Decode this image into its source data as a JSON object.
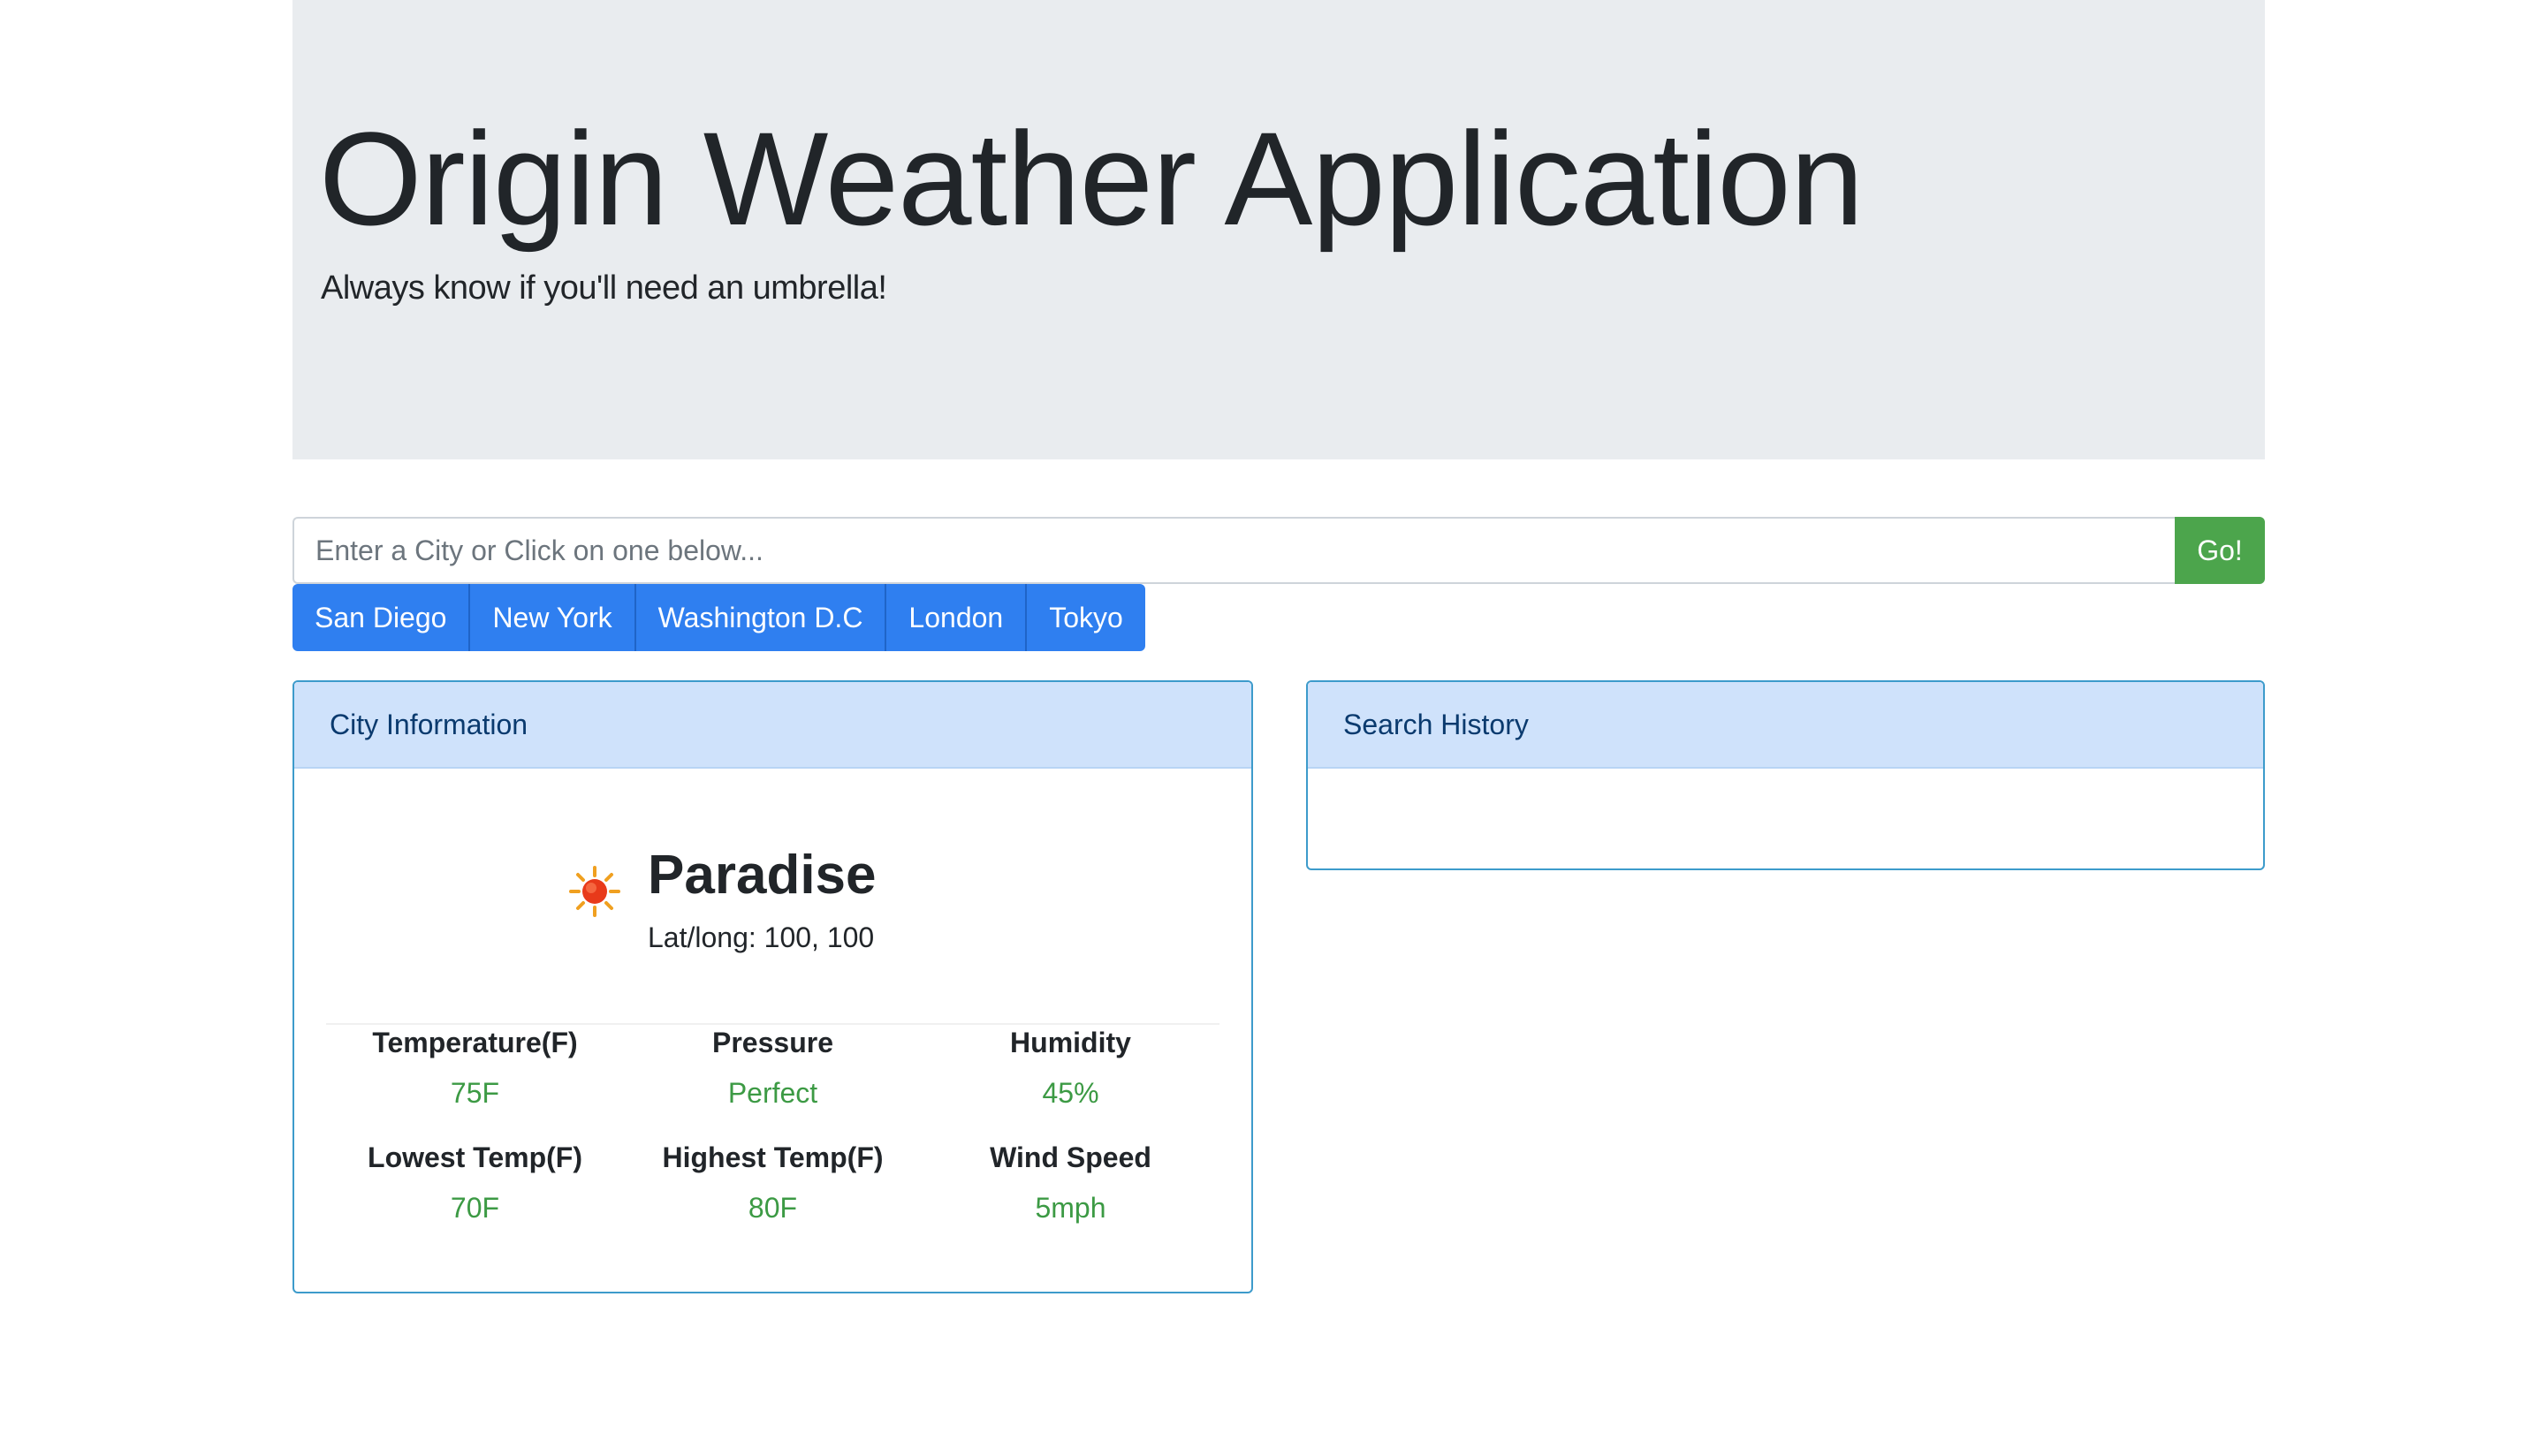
{
  "header": {
    "title": "Origin Weather Application",
    "subtitle": "Always know if you'll need an umbrella!"
  },
  "search": {
    "placeholder": "Enter a City or Click on one below...",
    "value": "",
    "go_label": "Go!"
  },
  "quick_cities": [
    "San Diego",
    "New York",
    "Washington D.C",
    "London",
    "Tokyo"
  ],
  "city_card": {
    "header": "City Information",
    "icon": "sun-icon",
    "city_name": "Paradise",
    "latlong": "Lat/long: 100, 100",
    "stats": [
      {
        "label": "Temperature(F)",
        "value": "75F"
      },
      {
        "label": "Pressure",
        "value": "Perfect"
      },
      {
        "label": "Humidity",
        "value": "45%"
      },
      {
        "label": "Lowest Temp(F)",
        "value": "70F"
      },
      {
        "label": "Highest Temp(F)",
        "value": "80F"
      },
      {
        "label": "Wind Speed",
        "value": "5mph"
      }
    ]
  },
  "history_card": {
    "header": "Search History",
    "items": []
  },
  "colors": {
    "jumbotron_bg": "#e9ecef",
    "primary": "#2f7ff0",
    "success": "#4ca54c",
    "card_border": "#3d9bcb",
    "card_header_bg": "#cfe2fb",
    "value_green": "#3c9a44"
  }
}
